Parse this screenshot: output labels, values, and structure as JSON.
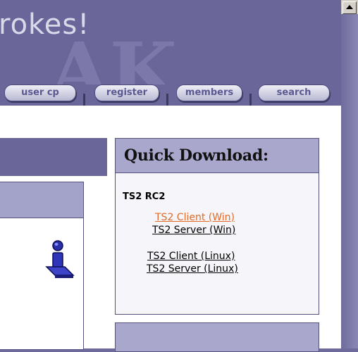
{
  "header": {
    "brand_text": "rokes!",
    "watermark_text": "AK"
  },
  "nav": {
    "tabs": [
      {
        "label": "user cp"
      },
      {
        "label": "register"
      },
      {
        "label": "members"
      },
      {
        "label": "search"
      }
    ]
  },
  "quick_download": {
    "title": "Quick Download:",
    "group_label": "TS2 RC2",
    "links": [
      {
        "label": "TS2 Client (Win)",
        "state": "hover"
      },
      {
        "label": "TS2 Server (Win)",
        "state": "normal"
      },
      {
        "label": "TS2 Client (Linux)",
        "state": "normal"
      },
      {
        "label": "TS2 Server (Linux)",
        "state": "normal"
      }
    ]
  },
  "colors": {
    "header_bg": "#6a6699",
    "panel_header": "#a9a8cc",
    "link_hover": "#e06a2a",
    "link": "#000000"
  },
  "icons": {
    "info": "info-person-icon"
  }
}
